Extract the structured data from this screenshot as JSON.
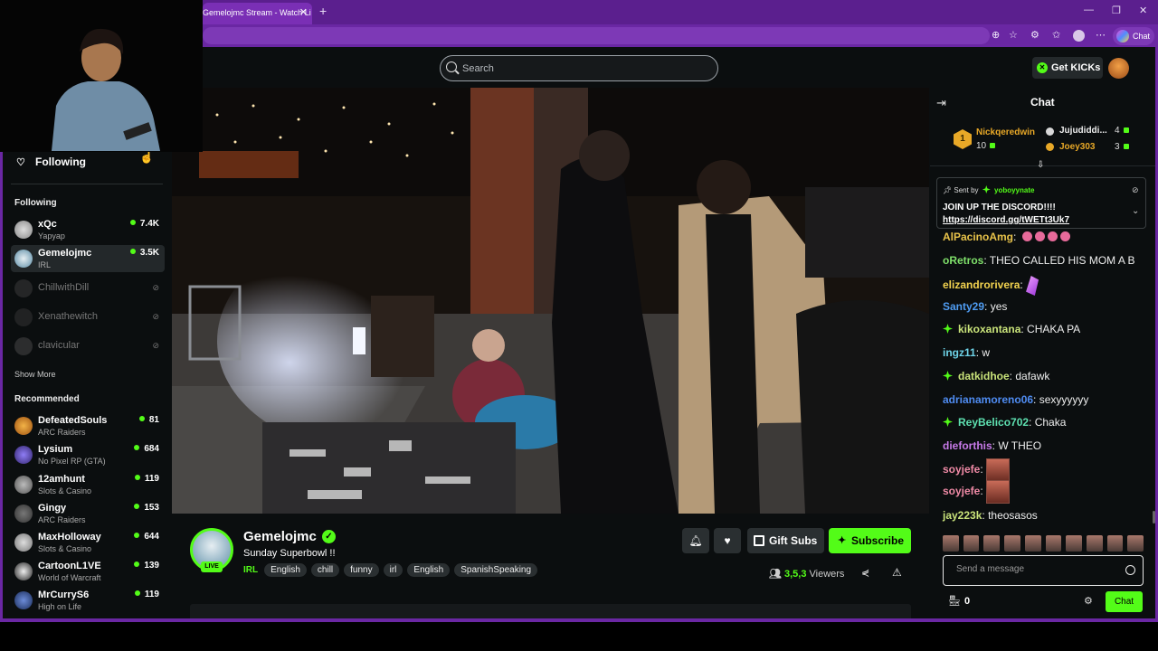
{
  "browser": {
    "tab_title": "Gemelojmc Stream - Watch Li",
    "new_tab": "+",
    "copilot_label": "Chat"
  },
  "header": {
    "search_placeholder": "Search",
    "get_kicks": "Get KICKs"
  },
  "sidebar": {
    "following_title": "Following",
    "following_section": "Following",
    "following": [
      {
        "name": "xQc",
        "sub": "Yapyap",
        "viewers": "7.4K",
        "live": true
      },
      {
        "name": "Gemelojmc",
        "sub": "IRL",
        "viewers": "3.5K",
        "live": true
      },
      {
        "name": "ChillwithDill",
        "sub": "",
        "viewers": "",
        "live": false
      },
      {
        "name": "Xenathewitch",
        "sub": "",
        "viewers": "",
        "live": false
      },
      {
        "name": "clavicular",
        "sub": "",
        "viewers": "",
        "live": false
      }
    ],
    "show_more": "Show More",
    "recommended_section": "Recommended",
    "recommended": [
      {
        "name": "DefeatedSouls",
        "sub": "ARC Raiders",
        "viewers": "81"
      },
      {
        "name": "Lysium",
        "sub": "No Pixel RP (GTA)",
        "viewers": "684"
      },
      {
        "name": "12amhunt",
        "sub": "Slots & Casino",
        "viewers": "119"
      },
      {
        "name": "Gingy",
        "sub": "ARC Raiders",
        "viewers": "153"
      },
      {
        "name": "MaxHolloway",
        "sub": "Slots & Casino",
        "viewers": "644"
      },
      {
        "name": "CartoonL1VE",
        "sub": "World of Warcraft",
        "viewers": "139"
      },
      {
        "name": "MrCurryS6",
        "sub": "High on Life",
        "viewers": "119"
      }
    ]
  },
  "stream": {
    "streamer": "Gemelojmc",
    "live_badge": "LIVE",
    "title": "Sunday Superbowl !!",
    "category": "IRL",
    "tags": [
      "English",
      "chill",
      "funny",
      "irl",
      "English",
      "SpanishSpeaking"
    ],
    "gift_subs": "Gift Subs",
    "subscribe": "Subscribe",
    "viewer_count": "3,5,3",
    "viewers_label": "Viewers"
  },
  "chat": {
    "title": "Chat",
    "top_gifters": [
      {
        "rank": "1",
        "name": "Nickqeredwin",
        "count": "10",
        "color": "#e8a827"
      },
      {
        "rank": "2",
        "name": "Jujudiddi...",
        "count": "4",
        "color": "#d8d8d8"
      },
      {
        "rank": "3",
        "name": "Joey303",
        "count": "3",
        "color": "#e8a827"
      }
    ],
    "pinned": {
      "sent_by_label": "Sent by",
      "sender": "yoboyynate",
      "message": "JOIN UP THE DISCORD!!!!",
      "link": "https://discord.gg/tWETt3Uk7"
    },
    "messages": [
      {
        "user": "AlPacinoAmg",
        "text": "",
        "color": "#e8c34a"
      },
      {
        "user": "oRetros",
        "text": "THEO CALLED HIS MOM A B",
        "color": "#7fe06a"
      },
      {
        "user": "elizandrorivera",
        "text": "",
        "color": "#f2d24f"
      },
      {
        "user": "Santy29",
        "text": "yes",
        "color": "#4f9cf2"
      },
      {
        "user": "kikoxantana",
        "text": "CHAKA PA",
        "color": "#c9e37a"
      },
      {
        "user": "ingz11",
        "text": "w",
        "color": "#6ed3e8"
      },
      {
        "user": "datkidhoe",
        "text": "dafawk",
        "color": "#c9e37a"
      },
      {
        "user": "adrianamoreno06",
        "text": "sexyyyyyy",
        "color": "#4f8cf2"
      },
      {
        "user": "ReyBelico702",
        "text": "Chaka",
        "color": "#5ee0b0"
      },
      {
        "user": "dieforthis",
        "text": "W THEO",
        "color": "#c77ae8"
      },
      {
        "user": "soyjefe",
        "text": "",
        "color": "#f08aa6"
      },
      {
        "user": "soyjefe",
        "text": "",
        "color": "#f08aa6"
      },
      {
        "user": "jay223k",
        "text": "theosasos",
        "color": "#c9e37a"
      }
    ],
    "input_placeholder": "Send a message",
    "kicks_count": "0",
    "send_button": "Chat"
  },
  "colors": {
    "brand_green": "#53fc18",
    "browser_purple": "#6a27a3",
    "background": "#0b0e0f"
  }
}
